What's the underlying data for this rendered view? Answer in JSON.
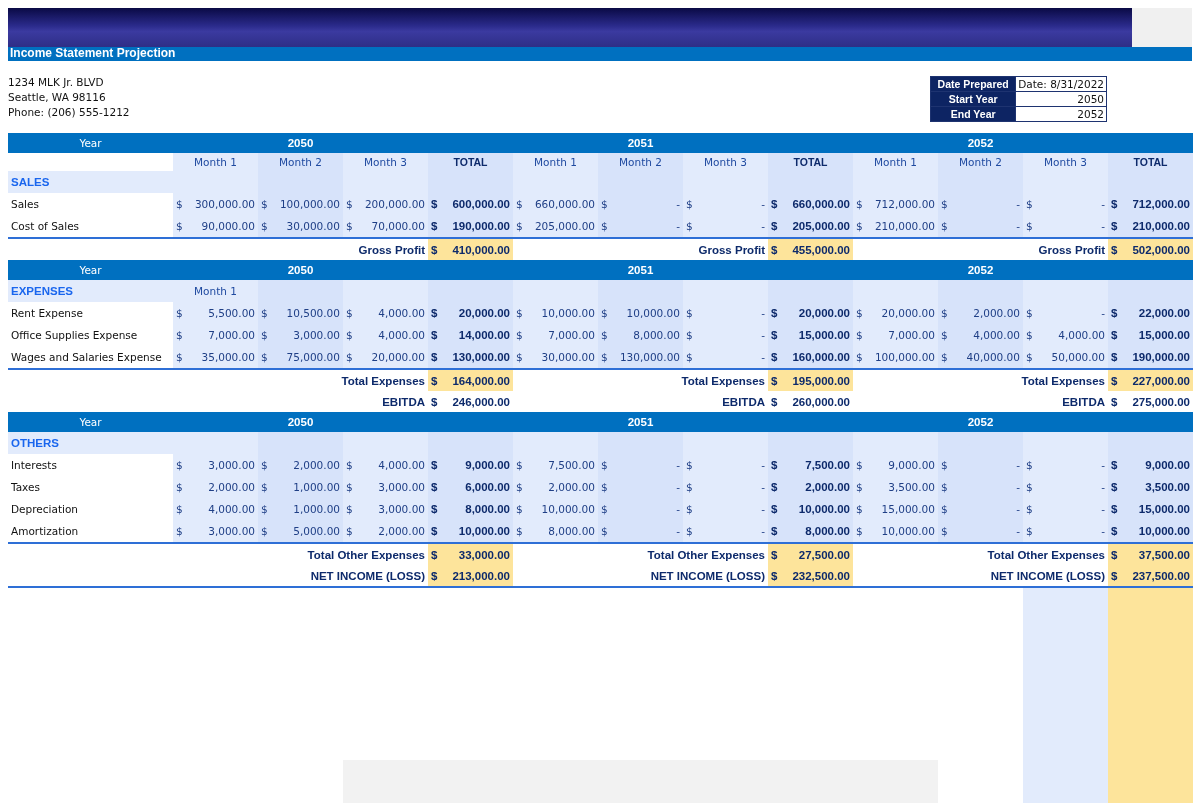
{
  "banner": {
    "title": "Income Statement Projection"
  },
  "address": [
    "1234 MLK Jr. BLVD",
    "Seattle, WA 98116",
    "Phone: (206) 555-1212"
  ],
  "info_table": [
    {
      "label": "Date Prepared",
      "value": "Date: 8/31/2022"
    },
    {
      "label": "Start Year",
      "value": "2050"
    },
    {
      "label": "End Year",
      "value": "2052"
    }
  ],
  "sections": [
    {
      "year_label": "Year",
      "years": [
        "2050",
        "2051",
        "2052"
      ],
      "month_row": [
        "Month 1",
        "Month 2",
        "Month 3",
        "TOTAL",
        "Month 1",
        "Month 2",
        "Month 3",
        "TOTAL",
        "Month 1",
        "Month 2",
        "Month 3",
        "TOTAL"
      ],
      "title": "SALES",
      "rows": [
        {
          "label": "Sales",
          "cells": [
            [
              "$",
              "300,000.00"
            ],
            [
              "$",
              "100,000.00"
            ],
            [
              "$",
              "200,000.00"
            ],
            [
              "$",
              "600,000.00"
            ],
            [
              "$",
              "660,000.00"
            ],
            [
              "$",
              "-"
            ],
            [
              "$",
              "-"
            ],
            [
              "$",
              "660,000.00"
            ],
            [
              "$",
              "712,000.00"
            ],
            [
              "$",
              "-"
            ],
            [
              "$",
              "-"
            ],
            [
              "$",
              "712,000.00"
            ]
          ]
        },
        {
          "label": "Cost of Sales",
          "cells": [
            [
              "$",
              "90,000.00"
            ],
            [
              "$",
              "30,000.00"
            ],
            [
              "$",
              "70,000.00"
            ],
            [
              "$",
              "190,000.00"
            ],
            [
              "$",
              "205,000.00"
            ],
            [
              "$",
              "-"
            ],
            [
              "$",
              "-"
            ],
            [
              "$",
              "205,000.00"
            ],
            [
              "$",
              "210,000.00"
            ],
            [
              "$",
              "-"
            ],
            [
              "$",
              "-"
            ],
            [
              "$",
              "210,000.00"
            ]
          ]
        }
      ],
      "summaries": [
        {
          "highlight": true,
          "items": [
            {
              "label": "Gross Profit",
              "cell": [
                "$",
                "410,000.00"
              ]
            },
            {
              "label": "Gross Profit",
              "cell": [
                "$",
                "455,000.00"
              ]
            },
            {
              "label": "Gross Profit",
              "cell": [
                "$",
                "502,000.00"
              ]
            }
          ]
        }
      ]
    },
    {
      "year_label": "Year",
      "years": [
        "2050",
        "2051",
        "2052"
      ],
      "title": "EXPENSES",
      "title_row_cells": [
        "Month 1"
      ],
      "rows": [
        {
          "label": "Rent Expense",
          "cells": [
            [
              "$",
              "5,500.00"
            ],
            [
              "$",
              "10,500.00"
            ],
            [
              "$",
              "4,000.00"
            ],
            [
              "$",
              "20,000.00"
            ],
            [
              "$",
              "10,000.00"
            ],
            [
              "$",
              "10,000.00"
            ],
            [
              "$",
              "-"
            ],
            [
              "$",
              "20,000.00"
            ],
            [
              "$",
              "20,000.00"
            ],
            [
              "$",
              "2,000.00"
            ],
            [
              "$",
              "-"
            ],
            [
              "$",
              "22,000.00"
            ]
          ]
        },
        {
          "label": "Office Supplies Expense",
          "cells": [
            [
              "$",
              "7,000.00"
            ],
            [
              "$",
              "3,000.00"
            ],
            [
              "$",
              "4,000.00"
            ],
            [
              "$",
              "14,000.00"
            ],
            [
              "$",
              "7,000.00"
            ],
            [
              "$",
              "8,000.00"
            ],
            [
              "$",
              "-"
            ],
            [
              "$",
              "15,000.00"
            ],
            [
              "$",
              "7,000.00"
            ],
            [
              "$",
              "4,000.00"
            ],
            [
              "$",
              "4,000.00"
            ],
            [
              "$",
              "15,000.00"
            ]
          ]
        },
        {
          "label": "Wages and Salaries Expense",
          "cells": [
            [
              "$",
              "35,000.00"
            ],
            [
              "$",
              "75,000.00"
            ],
            [
              "$",
              "20,000.00"
            ],
            [
              "$",
              "130,000.00"
            ],
            [
              "$",
              "30,000.00"
            ],
            [
              "$",
              "130,000.00"
            ],
            [
              "$",
              "-"
            ],
            [
              "$",
              "160,000.00"
            ],
            [
              "$",
              "100,000.00"
            ],
            [
              "$",
              "40,000.00"
            ],
            [
              "$",
              "50,000.00"
            ],
            [
              "$",
              "190,000.00"
            ]
          ]
        }
      ],
      "summaries": [
        {
          "highlight": true,
          "items": [
            {
              "label": "Total Expenses",
              "cell": [
                "$",
                "164,000.00"
              ]
            },
            {
              "label": "Total Expenses",
              "cell": [
                "$",
                "195,000.00"
              ]
            },
            {
              "label": "Total Expenses",
              "cell": [
                "$",
                "227,000.00"
              ]
            }
          ]
        },
        {
          "highlight": false,
          "items": [
            {
              "label": "EBITDA",
              "cell": [
                "$",
                "246,000.00"
              ]
            },
            {
              "label": "EBITDA",
              "cell": [
                "$",
                "260,000.00"
              ]
            },
            {
              "label": "EBITDA",
              "cell": [
                "$",
                "275,000.00"
              ]
            }
          ]
        }
      ]
    },
    {
      "year_label": "Year",
      "years": [
        "2050",
        "2051",
        "2052"
      ],
      "title": "OTHERS",
      "rows": [
        {
          "label": "Interests",
          "cells": [
            [
              "$",
              "3,000.00"
            ],
            [
              "$",
              "2,000.00"
            ],
            [
              "$",
              "4,000.00"
            ],
            [
              "$",
              "9,000.00"
            ],
            [
              "$",
              "7,500.00"
            ],
            [
              "$",
              "-"
            ],
            [
              "$",
              "-"
            ],
            [
              "$",
              "7,500.00"
            ],
            [
              "$",
              "9,000.00"
            ],
            [
              "$",
              "-"
            ],
            [
              "$",
              "-"
            ],
            [
              "$",
              "9,000.00"
            ]
          ]
        },
        {
          "label": "Taxes",
          "cells": [
            [
              "$",
              "2,000.00"
            ],
            [
              "$",
              "1,000.00"
            ],
            [
              "$",
              "3,000.00"
            ],
            [
              "$",
              "6,000.00"
            ],
            [
              "$",
              "2,000.00"
            ],
            [
              "$",
              "-"
            ],
            [
              "$",
              "-"
            ],
            [
              "$",
              "2,000.00"
            ],
            [
              "$",
              "3,500.00"
            ],
            [
              "$",
              "-"
            ],
            [
              "$",
              "-"
            ],
            [
              "$",
              "3,500.00"
            ]
          ]
        },
        {
          "label": "Depreciation",
          "cells": [
            [
              "$",
              "4,000.00"
            ],
            [
              "$",
              "1,000.00"
            ],
            [
              "$",
              "3,000.00"
            ],
            [
              "$",
              "8,000.00"
            ],
            [
              "$",
              "10,000.00"
            ],
            [
              "$",
              "-"
            ],
            [
              "$",
              "-"
            ],
            [
              "$",
              "10,000.00"
            ],
            [
              "$",
              "15,000.00"
            ],
            [
              "$",
              "-"
            ],
            [
              "$",
              "-"
            ],
            [
              "$",
              "15,000.00"
            ]
          ]
        },
        {
          "label": "Amortization",
          "cells": [
            [
              "$",
              "3,000.00"
            ],
            [
              "$",
              "5,000.00"
            ],
            [
              "$",
              "2,000.00"
            ],
            [
              "$",
              "10,000.00"
            ],
            [
              "$",
              "8,000.00"
            ],
            [
              "$",
              "-"
            ],
            [
              "$",
              "-"
            ],
            [
              "$",
              "8,000.00"
            ],
            [
              "$",
              "10,000.00"
            ],
            [
              "$",
              "-"
            ],
            [
              "$",
              "-"
            ],
            [
              "$",
              "10,000.00"
            ]
          ]
        }
      ],
      "summaries": [
        {
          "highlight": true,
          "items": [
            {
              "label": "Total Other Expenses",
              "cell": [
                "$",
                "33,000.00"
              ]
            },
            {
              "label": "Total Other Expenses",
              "cell": [
                "$",
                "27,500.00"
              ]
            },
            {
              "label": "Total Other Expenses",
              "cell": [
                "$",
                "37,500.00"
              ]
            }
          ]
        },
        {
          "highlight": true,
          "items": [
            {
              "label": "NET INCOME (LOSS)",
              "cell": [
                "$",
                "213,000.00"
              ]
            },
            {
              "label": "NET INCOME (LOSS)",
              "cell": [
                "$",
                "232,500.00"
              ]
            },
            {
              "label": "NET INCOME (LOSS)",
              "cell": [
                "$",
                "237,500.00"
              ]
            }
          ]
        }
      ]
    }
  ]
}
